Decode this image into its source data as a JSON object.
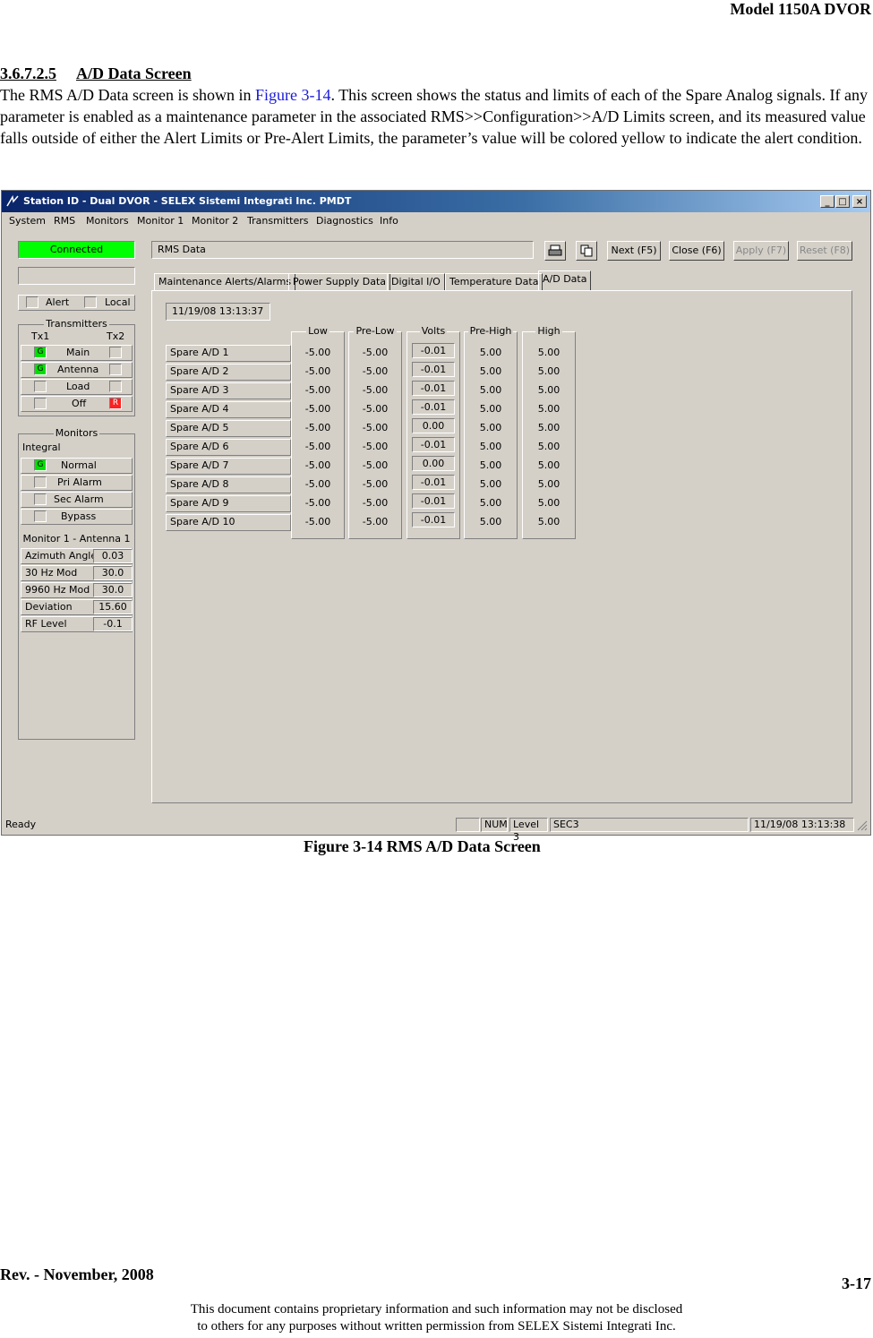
{
  "page_header": "Model 1150A DVOR",
  "section": {
    "number": "3.6.7.2.5",
    "title": "A/D Data Screen"
  },
  "paragraph": {
    "before_link": "The RMS A/D Data screen is shown in ",
    "link": "Figure 3-14",
    "after_link": ". This screen shows the status and limits of each of the Spare Analog signals. If any parameter is enabled as a maintenance parameter in the associated RMS>>Configuration>>A/D Limits screen, and its measured value falls outside of either the Alert Limits or Pre-Alert Limits, the parameter’s value will be colored yellow to indicate the alert condition."
  },
  "window": {
    "title": "Station ID - Dual DVOR - SELEX Sistemi Integrati Inc. PMDT",
    "title_buttons": [
      "_",
      "□",
      "×"
    ],
    "menu": [
      "System",
      "RMS",
      "Monitors",
      "Monitor 1",
      "Monitor 2",
      "Transmitters",
      "Diagnostics",
      "Info"
    ],
    "connection_status": "Connected",
    "screen_name": "RMS Data",
    "buttons": {
      "print_icon": "printer-icon",
      "copy_icon": "copy-icon",
      "next": "Next (F5)",
      "close": "Close (F6)",
      "apply": "Apply (F7)",
      "reset": "Reset (F8)"
    },
    "alert_label": "Alert",
    "local_label": "Local",
    "transmitters": {
      "legend": "Transmitters",
      "tx1": "Tx1",
      "tx2": "Tx2",
      "rows": [
        {
          "label": "Main",
          "left": "G",
          "right": ""
        },
        {
          "label": "Antenna",
          "left": "G",
          "right": ""
        },
        {
          "label": "Load",
          "left": "",
          "right": ""
        },
        {
          "label": "Off",
          "left": "",
          "right": "R"
        }
      ]
    },
    "monitors": {
      "legend": "Monitors",
      "integral": "Integral",
      "rows": [
        {
          "label": "Normal",
          "ind": "G"
        },
        {
          "label": "Pri Alarm",
          "ind": ""
        },
        {
          "label": "Sec Alarm",
          "ind": ""
        },
        {
          "label": "Bypass",
          "ind": ""
        }
      ],
      "antenna_title": "Monitor 1 - Antenna 1",
      "measurements": [
        {
          "label": "Azimuth Angle",
          "value": "0.03"
        },
        {
          "label": "30 Hz Mod",
          "value": "30.0"
        },
        {
          "label": "9960 Hz Mod",
          "value": "30.0"
        },
        {
          "label": "Deviation",
          "value": "15.60"
        },
        {
          "label": "RF Level",
          "value": "-0.1"
        }
      ]
    },
    "tabs": [
      "Maintenance Alerts/Alarms",
      "Power Supply Data",
      "Digital I/O",
      "Temperature Data",
      "A/D Data"
    ],
    "active_tab": "A/D Data",
    "timestamp": "11/19/08 13:13:37",
    "table": {
      "columns": [
        "Low",
        "Pre-Low",
        "Volts",
        "Pre-High",
        "High"
      ],
      "rows": [
        {
          "name": "Spare A/D 1",
          "low": "-5.00",
          "prelow": "-5.00",
          "volts": "-0.01",
          "prehigh": "5.00",
          "high": "5.00"
        },
        {
          "name": "Spare A/D 2",
          "low": "-5.00",
          "prelow": "-5.00",
          "volts": "-0.01",
          "prehigh": "5.00",
          "high": "5.00"
        },
        {
          "name": "Spare A/D 3",
          "low": "-5.00",
          "prelow": "-5.00",
          "volts": "-0.01",
          "prehigh": "5.00",
          "high": "5.00"
        },
        {
          "name": "Spare A/D 4",
          "low": "-5.00",
          "prelow": "-5.00",
          "volts": "-0.01",
          "prehigh": "5.00",
          "high": "5.00"
        },
        {
          "name": "Spare A/D 5",
          "low": "-5.00",
          "prelow": "-5.00",
          "volts": "0.00",
          "prehigh": "5.00",
          "high": "5.00"
        },
        {
          "name": "Spare A/D 6",
          "low": "-5.00",
          "prelow": "-5.00",
          "volts": "-0.01",
          "prehigh": "5.00",
          "high": "5.00"
        },
        {
          "name": "Spare A/D 7",
          "low": "-5.00",
          "prelow": "-5.00",
          "volts": "0.00",
          "prehigh": "5.00",
          "high": "5.00"
        },
        {
          "name": "Spare A/D 8",
          "low": "-5.00",
          "prelow": "-5.00",
          "volts": "-0.01",
          "prehigh": "5.00",
          "high": "5.00"
        },
        {
          "name": "Spare A/D 9",
          "low": "-5.00",
          "prelow": "-5.00",
          "volts": "-0.01",
          "prehigh": "5.00",
          "high": "5.00"
        },
        {
          "name": "Spare A/D 10",
          "low": "-5.00",
          "prelow": "-5.00",
          "volts": "-0.01",
          "prehigh": "5.00",
          "high": "5.00"
        }
      ]
    },
    "statusbar": {
      "ready": "Ready",
      "num": "NUM",
      "level": "Level 3",
      "sec": "SEC3",
      "time": "11/19/08 13:13:38"
    }
  },
  "caption": "Figure 3-14  RMS A/D Data Screen",
  "footer": {
    "revision": "Rev. -  November, 2008",
    "page": "3-17",
    "notice_line1": "This document contains proprietary information and such information may not be disclosed",
    "notice_line2": "to others for any purposes without written permission from SELEX Sistemi Integrati Inc."
  }
}
